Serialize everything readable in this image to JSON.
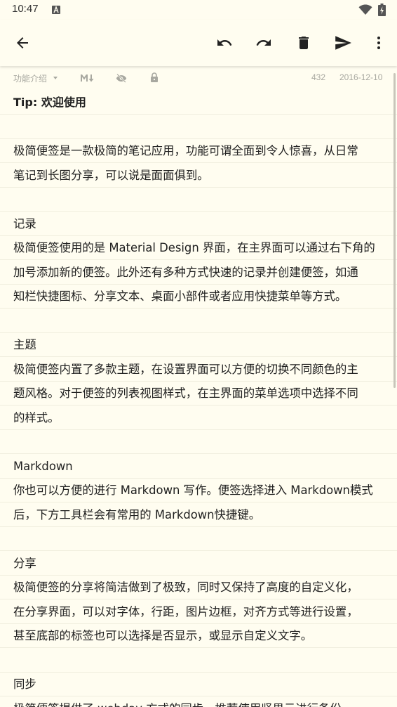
{
  "status_bar": {
    "time": "10:47",
    "icons": [
      "a-notification-icon",
      "wifi-icon",
      "battery-icon"
    ]
  },
  "toolbar": {
    "buttons": [
      "back-arrow-icon",
      "undo-icon",
      "redo-icon",
      "delete-icon",
      "send-icon",
      "more-vert-icon"
    ]
  },
  "note_meta": {
    "category": "功能介绍",
    "count": "432",
    "date": "2016-12-10"
  },
  "note": {
    "lines": [
      {
        "text": "Tip: 欢迎使用",
        "style": "title"
      },
      {
        "text": ""
      },
      {
        "text": "极简便签是一款极简的笔记应用，功能可谓全面到令人惊喜，从日常"
      },
      {
        "text": "笔记到长图分享，可以说是面面俱到。"
      },
      {
        "text": ""
      },
      {
        "text": "记录"
      },
      {
        "text": "极简便签使用的是 Material Design 界面，在主界面可以通过右下角的"
      },
      {
        "text": "加号添加新的便签。此外还有多种方式快速的记录并创建便签，如通"
      },
      {
        "text": "知栏快捷图标、分享文本、桌面小部件或者应用快捷菜单等方式。"
      },
      {
        "text": ""
      },
      {
        "text": "主题"
      },
      {
        "text": "极简便签内置了多款主题，在设置界面可以方便的切换不同颜色的主"
      },
      {
        "text": "题风格。对于便签的列表视图样式，在主界面的菜单选项中选择不同"
      },
      {
        "text": "的样式。"
      },
      {
        "text": ""
      },
      {
        "text": "Markdown"
      },
      {
        "text": "你也可以方便的进行 Markdown 写作。便签选择进入 Markdown模式"
      },
      {
        "text": "后，下方工具栏会有常用的 Markdown快捷键。"
      },
      {
        "text": ""
      },
      {
        "text": "分享"
      },
      {
        "text": "极简便签的分享将简洁做到了极致，同时又保持了高度的自定义化，"
      },
      {
        "text": "在分享界面，可以对字体，行距，图片边框，对齐方式等进行设置，"
      },
      {
        "text": "甚至底部的标签也可以选择是否显示，或显示自定义文字。"
      },
      {
        "text": ""
      },
      {
        "text": "同步"
      },
      {
        "text": "极简便签提供了 webdav 方式的同步，推荐使用坚果云进行备份"
      }
    ]
  },
  "colors": {
    "background": "#fffdf0",
    "text": "#212121",
    "meta_text": "#a8a8a0",
    "line_separator": "#f0eede"
  }
}
